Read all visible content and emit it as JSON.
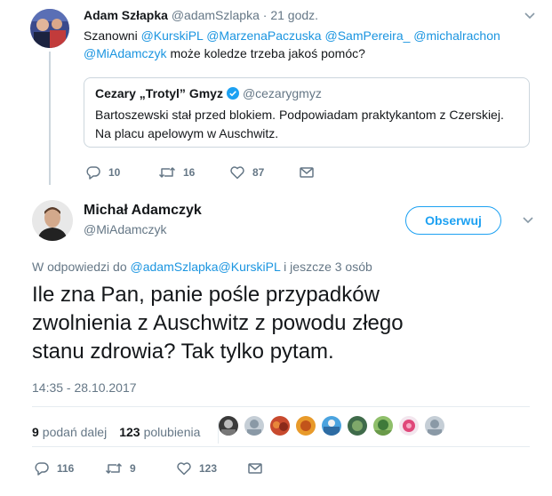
{
  "reply_tweet": {
    "author_name": "Adam Szłapka",
    "author_handle": "@adamSzlapka",
    "time": "21 godz.",
    "text_prefix": "Szanowni",
    "mentions": [
      "@KurskiPL",
      "@MarzenaPaczuska",
      "@SamPereira_",
      "@michalrachon",
      "@MiAdamczyk"
    ],
    "text_suffix": "może koledze trzeba jakoś pomóc?",
    "quoted": {
      "author_name": "Cezary „Trotyl” Gmyz",
      "author_handle": "@cezarygmyz",
      "text_line1": "Bartoszewski stał przed blokiem. Podpowiadam praktykantom z Czerskiej.",
      "text_line2": "Na placu apelowym w Auschwitz."
    },
    "actions": {
      "replies": "10",
      "retweets": "16",
      "likes": "87"
    }
  },
  "main_tweet": {
    "author_name": "Michał Adamczyk",
    "author_handle": "@MiAdamczyk",
    "follow_label": "Obserwuj",
    "reply_to_prefix": "W odpowiedzi do",
    "reply_to_users": "@adamSzlapka@KurskiPL",
    "reply_to_suffix": "i jeszcze 3 osób",
    "text_line1": "Ile zna Pan, panie pośle przypadków",
    "text_line2": "zwolnienia z Auschwitz z powodu złego",
    "text_line3": "stanu zdrowia? Tak tylko pytam.",
    "timestamp": "14:35 - 28.10.2017",
    "retweets_count": "9",
    "retweets_label": "podań dalej",
    "likes_count": "123",
    "likes_label": "polubienia",
    "actions": {
      "replies": "116",
      "retweets": "9",
      "likes": "123"
    }
  },
  "colors": {
    "link": "#1b95e0",
    "muted": "#657786",
    "follow": "#1da1f2",
    "verified": "#1da1f2"
  },
  "icons": [
    "reply-icon",
    "retweet-icon",
    "like-icon",
    "message-icon",
    "chevron-down-icon",
    "verified-badge-icon"
  ]
}
